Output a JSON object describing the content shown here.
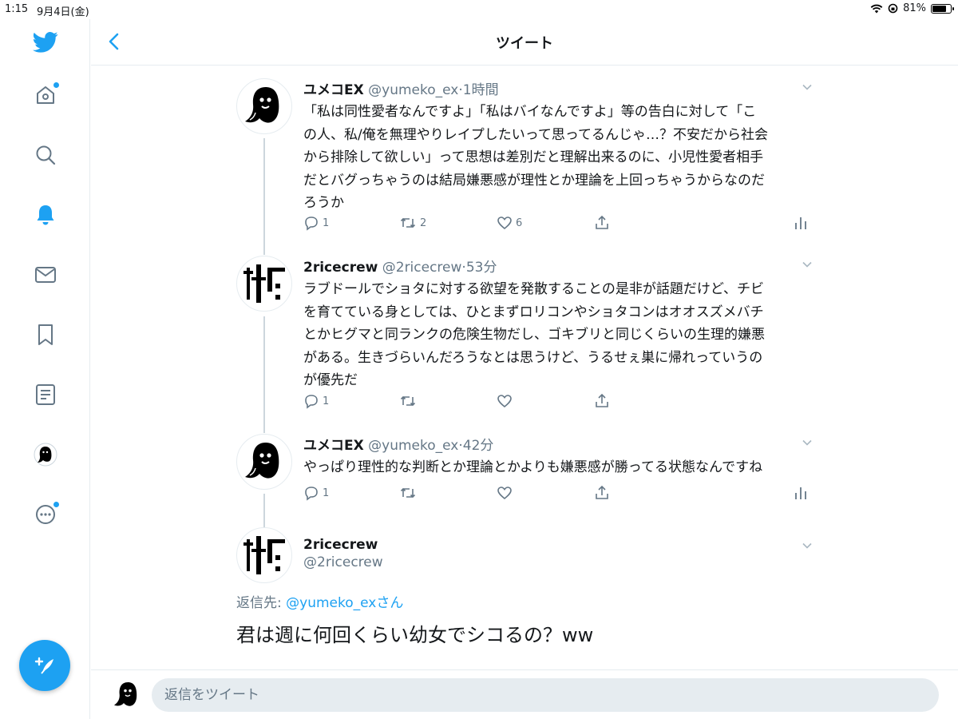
{
  "status": {
    "time": "1:15",
    "date": "9月4日(金)",
    "battery": "81%",
    "battery_level": 0.81
  },
  "header": {
    "title": "ツイート"
  },
  "tweets": [
    {
      "name": "ユメコEX",
      "handle": "@yumeko_ex",
      "time": "·1時間",
      "lines": [
        "「私は同性愛者なんですよ」「私はバイなんですよ」等の告白に対して「こ",
        "の人、私/俺を無理やりレイプしたいって思ってるんじゃ…？不安だから社会",
        "から排除して欲しい」って思想は差別だと理解出来るのに、小児性愛者相手",
        "だとバグっちゃうのは結局嫌悪感が理性とか理論を上回っちゃうからなのだ",
        "ろうか"
      ],
      "replies": "1",
      "retweets": "2",
      "likes": "6"
    },
    {
      "name": "2ricecrew",
      "handle": "@2ricecrew",
      "time": "·53分",
      "lines": [
        "ラブドールでショタに対する欲望を発散することの是非が話題だけど、チビ",
        "を育てている身としては、ひとまずロリコンやショタコンはオオスズメバチ",
        "とかヒグマと同ランクの危険生物だし、ゴキブリと同じくらいの生理的嫌悪",
        "がある。生きづらいんだろうなとは思うけど、うるせぇ巣に帰れっていうの",
        "が優先だ"
      ],
      "replies": "1",
      "retweets": "",
      "likes": ""
    },
    {
      "name": "ユメコEX",
      "handle": "@yumeko_ex",
      "time": "·42分",
      "lines": [
        "やっぱり理性的な判断とか理論とかよりも嫌悪感が勝ってる状態なんですね"
      ],
      "replies": "1",
      "retweets": "",
      "likes": ""
    }
  ],
  "main": {
    "name": "2ricecrew",
    "handle": "@2ricecrew",
    "reply_prefix": "返信先: ",
    "reply_handle": "@yumeko_ex",
    "reply_suffix": "さん",
    "text": "君は週に何回くらい幼女でシコるの？ww"
  },
  "reply_bar": {
    "placeholder": "返信をツイート"
  },
  "colors": {
    "accent": "#1da1f2",
    "text": "#14171a",
    "muted": "#657786",
    "border": "#e6ecf0"
  }
}
